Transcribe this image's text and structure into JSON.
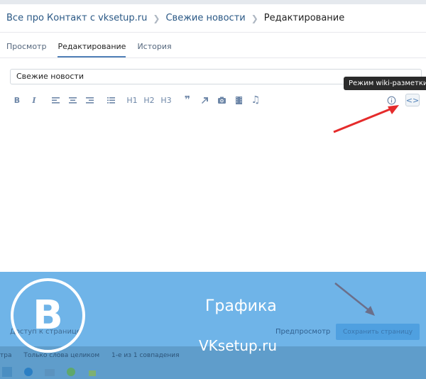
{
  "breadcrumb": {
    "items": [
      "Все про Контакт с vksetup.ru",
      "Свежие новости"
    ],
    "current": "Редактирование"
  },
  "tabs": [
    {
      "label": "Просмотр",
      "active": false
    },
    {
      "label": "Редактирование",
      "active": true
    },
    {
      "label": "История",
      "active": false
    }
  ],
  "page_title_value": "Свежие новости",
  "toolbar": {
    "bold": "B",
    "italic": "I",
    "h1": "H1",
    "h2": "H2",
    "h3": "H3",
    "quote": "❞",
    "tooltip": "Режим wiki-разметки",
    "wiki_label": "<>"
  },
  "footer": {
    "access_label": "Доступ к странице",
    "preview_label": "Предпросмотр",
    "save_label": "Сохранить страницу"
  },
  "watermark": {
    "logo_letter": "B",
    "heading": "Графика",
    "site": "VKsetup.ru"
  },
  "filters": {
    "part1": "тра",
    "part2": "Только слова целиком",
    "part3": "1-е из 1 совпадения"
  },
  "colors": {
    "accent": "#5181b8",
    "arrow_red": "#e52b2b",
    "overlay_blue": "#6fb4e8"
  }
}
